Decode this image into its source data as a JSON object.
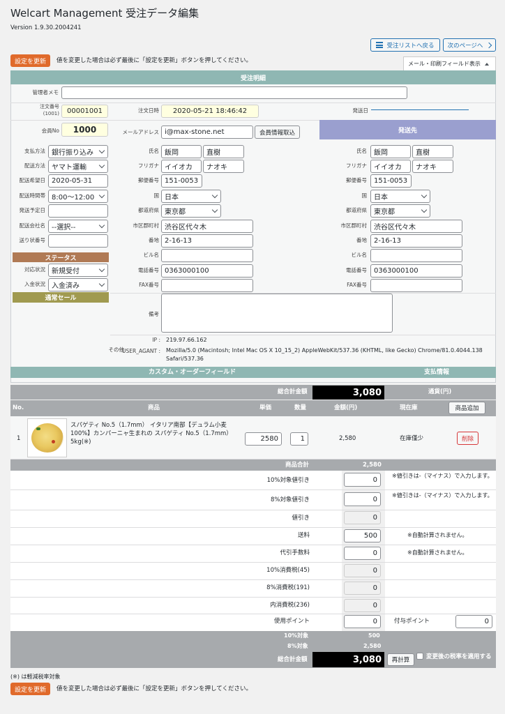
{
  "page": {
    "title": "Welcart Management 受注データ編集",
    "version": "Version 1.9.30.2004241"
  },
  "nav": {
    "back": "受注リストへ戻る",
    "next": "次のページへ"
  },
  "update_label": "設定を更新",
  "update_note": "値を変更した場合は必ず最後に「設定を更新」ボタンを押してください。",
  "mail_print": "メール・印刷フィールド表示",
  "order_detail": "受注明細",
  "memo_label": "管理者メモ",
  "order_no_label": "注文番号(1001)",
  "order_no": "00001001",
  "order_date_label": "注文日時",
  "order_date": "2020-05-21 18:46:42",
  "ship_date_label": "発送日",
  "member_no_label": "会員No",
  "member_no": "1000",
  "email_label": "メールアドレス",
  "email": "i@max-stone.net",
  "member_fetch": "会員情報取込",
  "shipping_header": "発送先",
  "left": {
    "labels": [
      "支払方法",
      "配送方法",
      "配送希望日",
      "配送時間帯",
      "発送予定日",
      "配送会社名",
      "送り状番号"
    ],
    "payment": "銀行振り込み",
    "delivery": "ヤマト運輸",
    "wish_date": "2020-05-31",
    "time": "8:00〜12:00",
    "carrier": "--選択--"
  },
  "status": {
    "title": "ステータス",
    "resp_label": "対応状況",
    "resp": "新規受付",
    "pay_label": "入金状況",
    "pay": "入金済み",
    "sale": "通常セール"
  },
  "addr_labels": {
    "name": "氏名",
    "kana": "フリガナ",
    "zip": "郵便番号",
    "country": "国",
    "pref": "都道府県",
    "city": "市区郡町村",
    "street": "番地",
    "bldg": "ビル名",
    "tel": "電話番号",
    "fax": "FAX番号"
  },
  "addr": {
    "sei": "飯岡",
    "mei": "直樹",
    "kana_sei": "イイオカ",
    "kana_mei": "ナオキ",
    "zip": "151-0053",
    "country": "日本",
    "pref": "東京都",
    "city": "渋谷区代々木",
    "street": "2-16-13",
    "tel": "0363000100"
  },
  "note_label": "備考",
  "other_label": "その他",
  "ip_label": "IP :",
  "ip": "219.97.66.162",
  "ua_label": "USER_AGANT :",
  "ua1": "Mozilla/5.0 (Macintosh; Intel Mac OS X 10_15_2) AppleWebKit/537.36 (KHTML, like Gecko) Chrome/81.0.4044.138",
  "ua2": "Safari/537.36",
  "custom_field": "カスタム・オーダーフィールド",
  "payment_info": "支払情報",
  "total_label": "総合計金額",
  "total": "3,080",
  "currency": "通貨(円)",
  "table": {
    "no": "No.",
    "product": "商品",
    "price": "単価",
    "qty": "数量",
    "amount": "金額(円)",
    "stock": "現在庫",
    "add": "商品追加"
  },
  "item": {
    "no": "1",
    "name": "スパゲティ No.5（1.7mm） イタリア南部【デュラム小麦100%】カンパーニャ生まれの スパゲティ No.5（1.7mm） 5kg(※)",
    "price": "2580",
    "qty": "1",
    "amount": "2,580",
    "stock": "在庫僅少",
    "delete": "削除"
  },
  "subtotal_label": "商品合計",
  "subtotal": "2,580",
  "fees": [
    {
      "label": "10%対象値引き",
      "value": "0",
      "note": "※値引きは-（マイナス）で入力します。"
    },
    {
      "label": "8%対象値引き",
      "value": "0",
      "note": "※値引きは-（マイナス）で入力します。"
    },
    {
      "label": "値引き",
      "value": "0",
      "note": ""
    },
    {
      "label": "送料",
      "value": "500",
      "note": "※自動計算されません。"
    },
    {
      "label": "代引手数料",
      "value": "0",
      "note": "※自動計算されません。"
    },
    {
      "label": "10%消費税(45)",
      "value": "0",
      "note": ""
    },
    {
      "label": "8%消費税(191)",
      "value": "0",
      "note": ""
    },
    {
      "label": "内消費税(236)",
      "value": "0",
      "note": ""
    }
  ],
  "points": {
    "use_label": "使用ポイント",
    "use": "0",
    "grant_label": "付与ポイント",
    "grant": "0"
  },
  "tax10_label": "10%対象",
  "tax10": "500",
  "tax8_label": "8%対象",
  "tax8": "2,580",
  "recalc": "再計算",
  "apply_rate": "変更後の税率を適用する",
  "reduced_note": "(※) は軽減税率対象"
}
